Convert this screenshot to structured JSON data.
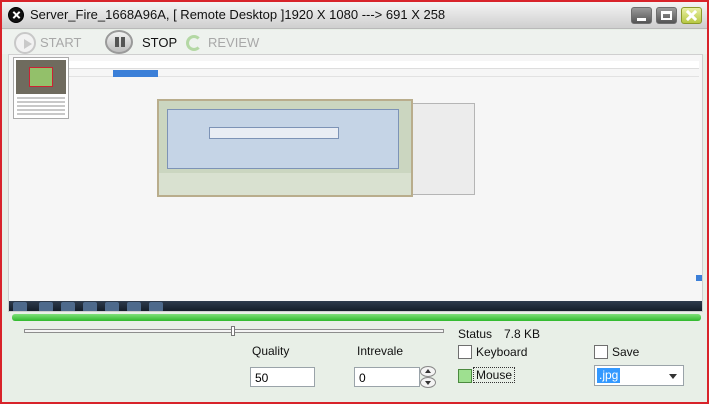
{
  "window": {
    "title": "Server_Fire_1668A96A,  [ Remote Desktop ]1920 X 1080 ---> 691 X 258",
    "icon": "app-close-circle-icon",
    "controls": [
      "minimize-icon",
      "maximize-icon",
      "close-icon"
    ]
  },
  "toolbar": {
    "start_label": "START",
    "stop_label": "STOP",
    "review_label": "REVIEW"
  },
  "remote_screen": {
    "description_icon": "remote-desktop-view"
  },
  "transfer": {
    "progress_fraction": 1.0
  },
  "controls": {
    "slider_fraction": 0.5,
    "status_label": "Status",
    "status_value": "7.8 KB",
    "quality_label": "Quality",
    "quality_value": "50",
    "intrevale_label": "Intrevale",
    "intrevale_value": "0",
    "keyboard_label": "Keyboard",
    "keyboard_checked": false,
    "mouse_label": "Mouse",
    "mouse_checked": true,
    "save_label": "Save",
    "save_checked": false,
    "format_value": ".jpg"
  },
  "colors": {
    "window_border": "#d8232a",
    "progress_fill": "#2fb92c",
    "selection": "#3399ff"
  }
}
